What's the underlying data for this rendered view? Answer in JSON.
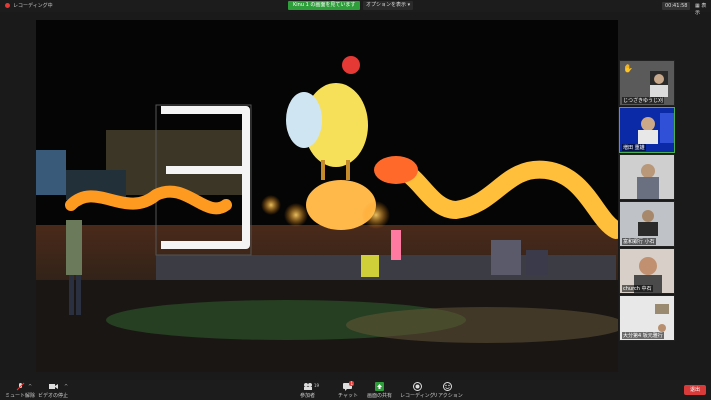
{
  "topbar": {
    "recording_label": "レコーディング中",
    "share_status": "Kinu 1 の画面を見ています",
    "view_options": "オプションを表示",
    "time": "00:41:58",
    "view_label": "表示"
  },
  "participants": [
    {
      "name": "じつざきゆうじ刈",
      "raised_hand": true
    },
    {
      "name": "増田 重雄",
      "raised_hand": false
    },
    {
      "name": "",
      "raised_hand": false
    },
    {
      "name": "富和銀行 小石",
      "raised_hand": false
    },
    {
      "name": "church 中石",
      "raised_hand": false
    },
    {
      "name": "大分第4 坂元雅行",
      "raised_hand": false
    }
  ],
  "toolbar": {
    "mute_label": "ミュート解除",
    "video_label": "ビデオの停止",
    "participants_label": "参加者",
    "participants_count": "19",
    "chat_label": "チャット",
    "chat_badge": "1",
    "share_label": "画面の共有",
    "record_label": "レコーディング",
    "reaction_label": "リアクション",
    "end_label": "退出"
  },
  "colors": {
    "share_green": "#2e9e3a",
    "end_red": "#d93b3b",
    "background": "#1a1a1a"
  },
  "icons": [
    "mic-muted-icon",
    "video-icon",
    "participants-icon",
    "chat-icon",
    "share-screen-icon",
    "record-icon",
    "reaction-icon",
    "hand-icon"
  ]
}
